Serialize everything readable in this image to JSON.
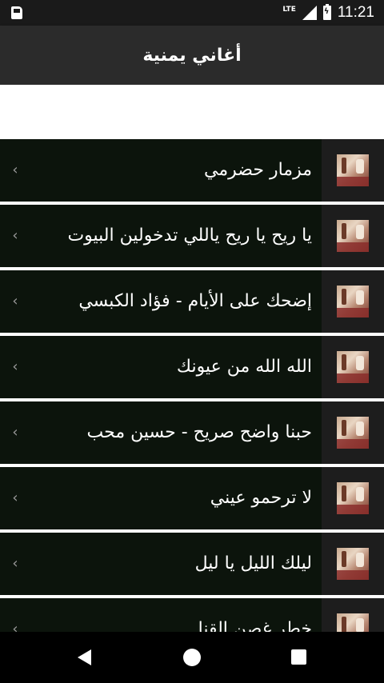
{
  "status_bar": {
    "network": "LTE",
    "time": "11:21",
    "icons": [
      "sim-card-icon",
      "signal-icon",
      "battery-charging-icon"
    ]
  },
  "app_bar": {
    "title": "أغاني يمنية"
  },
  "songs": [
    {
      "title": "مزمار حضرمي"
    },
    {
      "title": "يا ريح يا ريح ياللي تدخولين البيوت"
    },
    {
      "title": "إضحك على الأيام - فؤاد الكبسي"
    },
    {
      "title": "الله الله من عيونك"
    },
    {
      "title": "حبنا واضح صريح - حسين محب"
    },
    {
      "title": "لا ترحمو عيني"
    },
    {
      "title": "ليلك الليل يا ليل"
    },
    {
      "title": "خطر غصن القنا"
    }
  ],
  "list_icons": {
    "chevron": "chevron-left-icon",
    "thumbnail": "song-thumbnail"
  },
  "colors": {
    "app_bar": "#2b2b2b",
    "item_background": "#0c140c",
    "item_text": "#ffffff",
    "chevron": "#9a9a9a"
  }
}
